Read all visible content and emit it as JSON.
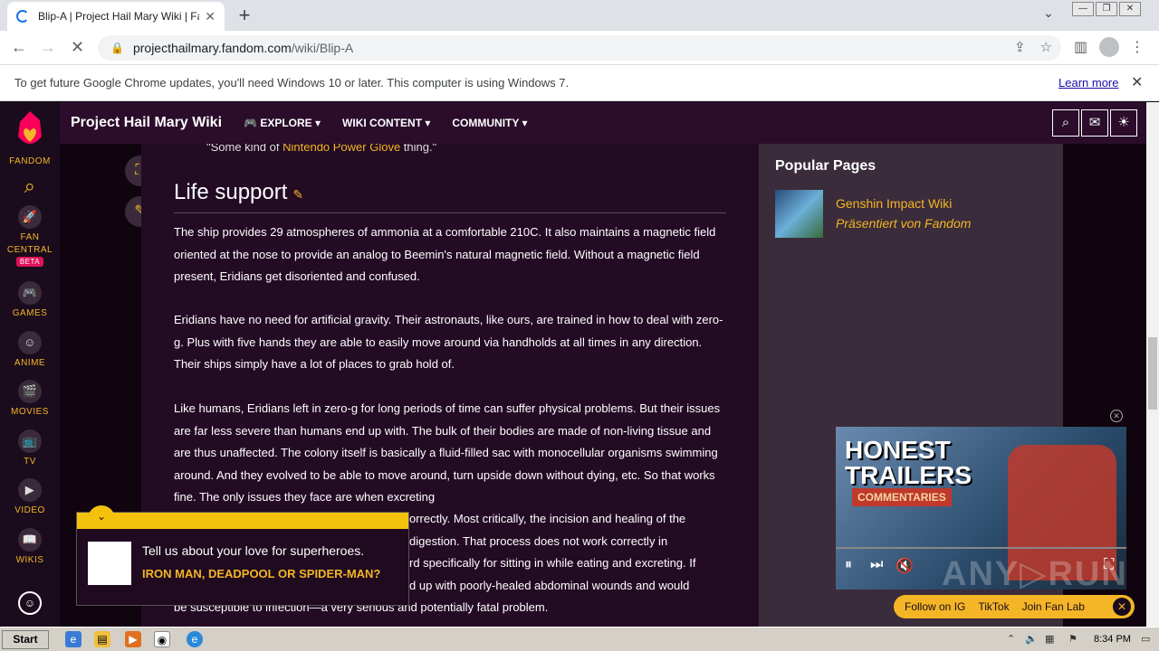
{
  "browser": {
    "tab_title": "Blip-A | Project Hail Mary Wiki | Fandom",
    "url_domain": "projecthailmary.fandom.com",
    "url_path": "/wiki/Blip-A"
  },
  "infobar": {
    "message": "To get future Google Chrome updates, you'll need Windows 10 or later. This computer is using Windows 7.",
    "learn_more": "Learn more"
  },
  "global_nav": {
    "fandom": "FANDOM",
    "fan_central_1": "FAN",
    "fan_central_2": "CENTRAL",
    "beta": "BETA",
    "games": "GAMES",
    "anime": "ANIME",
    "movies": "MOVIES",
    "tv": "TV",
    "video": "VIDEO",
    "wikis": "WIKIS"
  },
  "wiki_header": {
    "name": "Project Hail Mary Wiki",
    "explore": "EXPLORE",
    "wiki_content": "WIKI CONTENT",
    "community": "COMMUNITY"
  },
  "article": {
    "quote_start": "\"Some kind of ",
    "quote_link": "Nintendo Power Glove",
    "quote_end": " thing.\"",
    "heading": "Life support",
    "p1": "The ship provides 29 atmospheres of ammonia at a comfortable 210C. It also maintains a magnetic field oriented at the nose to provide an analog to Beemin's natural magnetic field. Without a magnetic field present, Eridians get disoriented and confused.",
    "p2": "Eridians have no need for artificial gravity. Their astronauts, like ours, are trained in how to deal with zero-g. Plus with five hands they are able to easily move around via handholds at all times in any direction. Their ships simply have a lot of places to grab hold of.",
    "p3": "Like humans, Eridians left in zero-g for long periods of time can suffer physical problems. But their issues are far less severe than humans end up with. The bulk of their bodies are made of non-living tissue and are thus unaffected. The colony itself is basically a fluid-filled sac with monocellular organisms swimming around. And they evolved to be able to move around, turn upside down without dying, etc. So that works fine. The only issues they face are when excreting",
    "p3b": "orrectly. Most critically, the incision and healing of the",
    "p3c": "digestion. That process does not work correctly in",
    "p3d": "rd specifically for sitting in while eating and excreting. If",
    "p3e": "d up with poorly-healed abdominal wounds and would",
    "p3f": "be susceptible to infection—a very serious and potentially fatal problem."
  },
  "sidebar": {
    "popular_title": "Popular Pages",
    "item_title": "Genshin Impact Wiki",
    "item_sub": "Präsentiert von Fandom"
  },
  "video": {
    "honest": "HONEST",
    "trailers": "TRAILERS",
    "commentaries": "COMMENTARIES",
    "progress": 0.0
  },
  "social": {
    "ig": "Follow on IG",
    "tiktok": "TikTok",
    "fanlab": "Join Fan Lab"
  },
  "quiz": {
    "question": "Tell us about your love for superheroes.",
    "answer": "IRON MAN, DEADPOOL OR SPIDER-MAN?"
  },
  "taskbar": {
    "start": "Start",
    "clock": "8:34 PM"
  }
}
